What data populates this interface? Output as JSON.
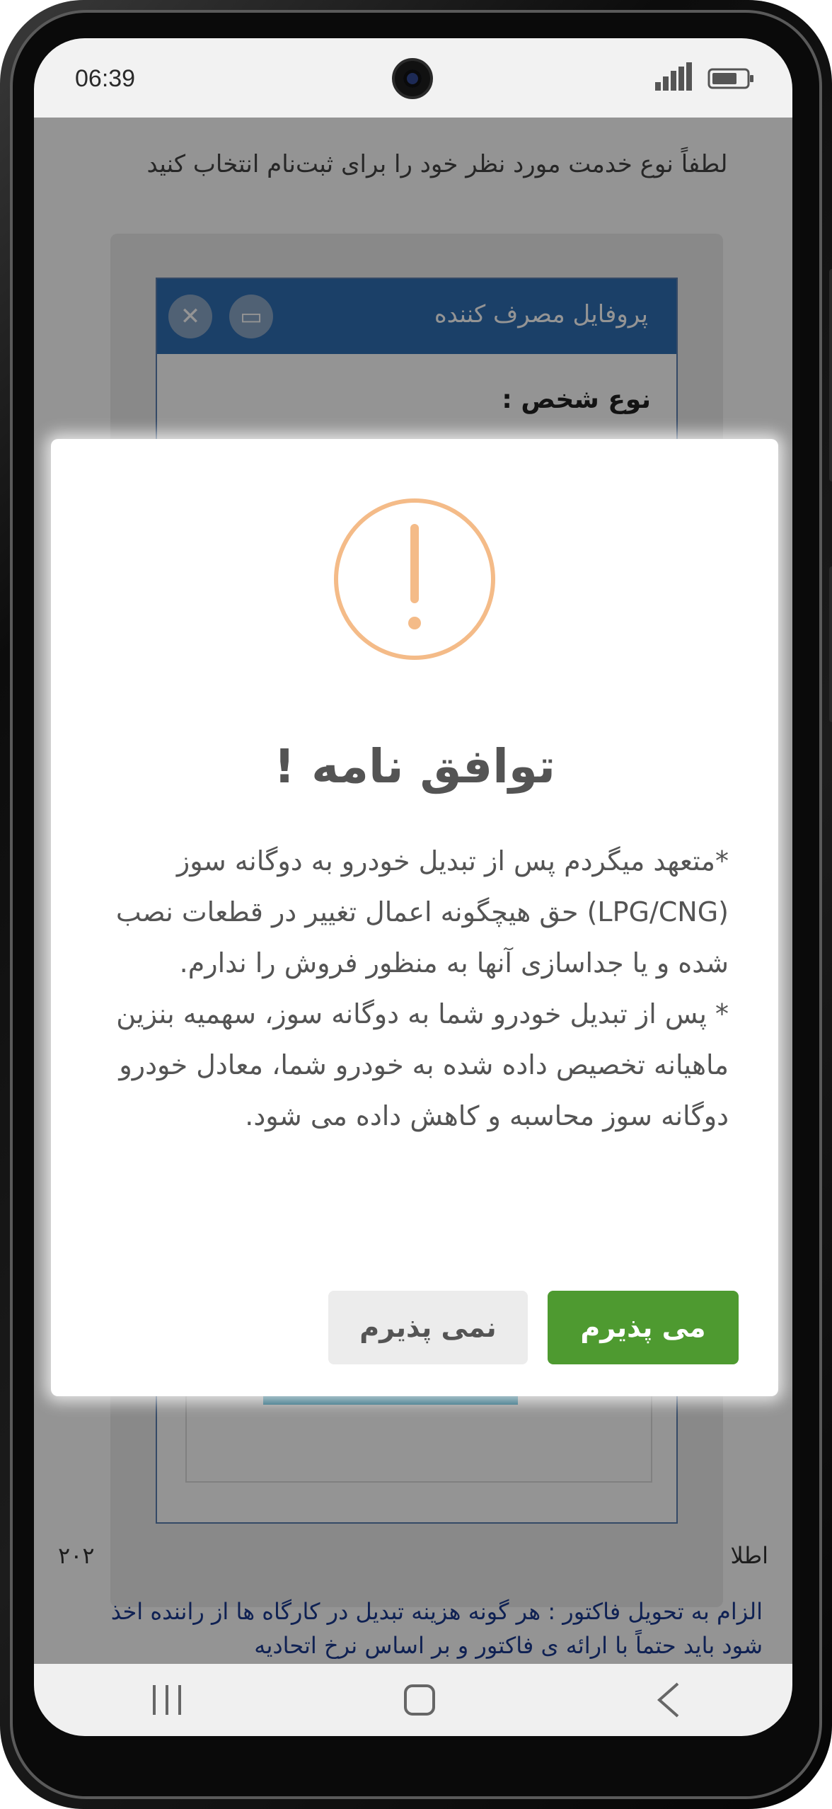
{
  "status_bar": {
    "time": "06:39"
  },
  "background_page": {
    "instruction": "لطفاً نوع خدمت مورد نظر خود را برای ثبت‌نام انتخاب کنید",
    "dialog_title": "پروفایل مصرف کننده",
    "close_glyph": "✕",
    "maximize_glyph": "▭",
    "person_type_label": "نوع شخص :",
    "footer_left": "۲۰۲",
    "footer_right": "اطلا",
    "note_text": "الزام به تحویل فاکتور : هر گونه هزینه تبدیل در کارگاه ها از راننده اخذ شود باید حتماً با ارائه ی فاکتور و بر اساس نرخ اتحادیه"
  },
  "modal": {
    "title": "توافق نامه !",
    "paragraphs": [
      "*متعهد میگردم پس از تبدیل خودرو به دوگانه سوز (LPG/CNG) حق هیچگونه اعمال تغییر در قطعات نصب شده و یا جداسازی آنها به منظور فروش را ندارم.",
      "* پس از تبدیل خودرو شما به دوگانه سوز، سهمیه بنزین ماهیانه تخصیص داده شده به خودرو شما، معادل خودرو دوگانه سوز محاسبه و کاهش داده می شود."
    ],
    "accept_label": "می پذیرم",
    "decline_label": "نمی پذیرم"
  },
  "icons": {
    "status": [
      "signal-icon",
      "battery-icon",
      "camera"
    ],
    "modal": "warning-icon",
    "nav": [
      "recent-apps-icon",
      "home-icon",
      "back-icon"
    ]
  },
  "colors": {
    "accept_green": "#4e9a30",
    "decline_gray": "#ececec",
    "warning_orange": "#f4bb88",
    "text_gray": "#545454",
    "dialog_header_blue": "#2f6eb3"
  }
}
